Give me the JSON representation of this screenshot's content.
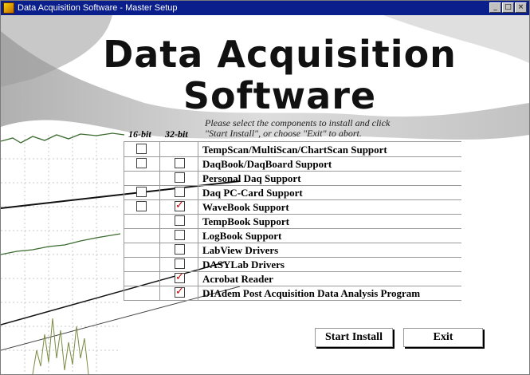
{
  "window": {
    "title": "Data Acquisition Software - Master Setup",
    "controls": [
      "_",
      "□",
      "×"
    ]
  },
  "heading": {
    "line1": "Data Acquisition",
    "line2": "Software"
  },
  "instructions": {
    "line1": "Please select the components to install and click",
    "line2": "\"Start Install\", or choose \"Exit\" to abort."
  },
  "columns": {
    "bit16": "16-bit",
    "bit32": "32-bit"
  },
  "components": [
    {
      "label": "TempScan/MultiScan/ChartScan Support",
      "has16": true,
      "has32": false,
      "checked16": false,
      "checked32": false
    },
    {
      "label": "DaqBook/DaqBoard Support",
      "has16": true,
      "has32": true,
      "checked16": false,
      "checked32": false
    },
    {
      "label": "Personal Daq Support",
      "has16": false,
      "has32": true,
      "checked16": false,
      "checked32": false
    },
    {
      "label": "Daq PC-Card Support",
      "has16": true,
      "has32": true,
      "checked16": false,
      "checked32": false
    },
    {
      "label": "WaveBook Support",
      "has16": true,
      "has32": true,
      "checked16": false,
      "checked32": true
    },
    {
      "label": "TempBook Support",
      "has16": false,
      "has32": true,
      "checked16": false,
      "checked32": false
    },
    {
      "label": "LogBook Support",
      "has16": false,
      "has32": true,
      "checked16": false,
      "checked32": false
    },
    {
      "label": "LabView Drivers",
      "has16": false,
      "has32": true,
      "checked16": false,
      "checked32": false
    },
    {
      "label": "DASYLab Drivers",
      "has16": false,
      "has32": true,
      "checked16": false,
      "checked32": false
    },
    {
      "label": "Acrobat Reader",
      "has16": false,
      "has32": true,
      "checked16": false,
      "checked32": true
    },
    {
      "label": "DIAdem Post Acquisition Data Analysis Program",
      "has16": false,
      "has32": true,
      "checked16": false,
      "checked32": true
    }
  ],
  "buttons": {
    "start": "Start Install",
    "exit": "Exit"
  },
  "colors": {
    "titlebar": "#0a1e8c",
    "check": "#c00000"
  }
}
